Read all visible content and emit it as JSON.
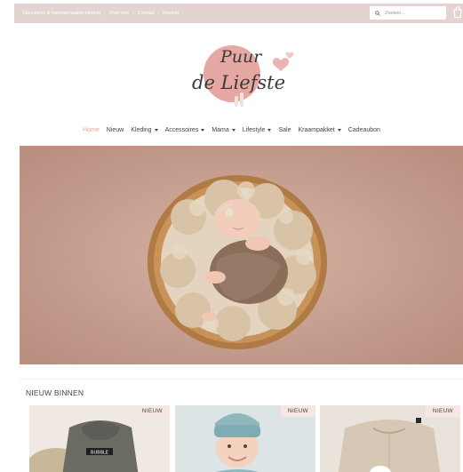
{
  "topbar": {
    "links": [
      "Duurzame & handgemaakte kleding",
      "Over ons",
      "Contact",
      "Kleding"
    ],
    "search_placeholder": "Zoeken..."
  },
  "logo": {
    "line1": "Puur",
    "line2": "de Liefste"
  },
  "nav": {
    "items": [
      {
        "label": "Home",
        "active": true,
        "dropdown": false
      },
      {
        "label": "Nieuw",
        "active": false,
        "dropdown": false
      },
      {
        "label": "Kleding",
        "active": false,
        "dropdown": true
      },
      {
        "label": "Accessoires",
        "active": false,
        "dropdown": true
      },
      {
        "label": "Mama",
        "active": false,
        "dropdown": true
      },
      {
        "label": "Lifestyle",
        "active": false,
        "dropdown": true
      },
      {
        "label": "Sale",
        "active": false,
        "dropdown": false
      },
      {
        "label": "Kraampakket",
        "active": false,
        "dropdown": true
      },
      {
        "label": "Cadeaubon",
        "active": false,
        "dropdown": false
      }
    ]
  },
  "section": {
    "title": "NIEUW BINNEN"
  },
  "products": [
    {
      "badge": "NIEUW",
      "print": "BUBBLE"
    },
    {
      "badge": "NIEUW"
    },
    {
      "badge": "NIEUW"
    }
  ],
  "colors": {
    "topbar": "#e3d3d1",
    "accent": "#e0a8a3",
    "hero_bg": "#c8a394",
    "badge_bg": "#f6e7e4"
  }
}
